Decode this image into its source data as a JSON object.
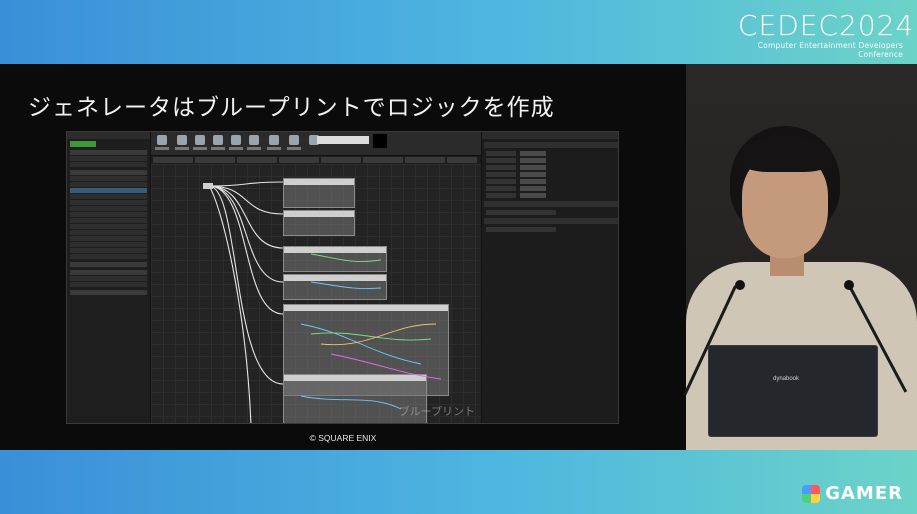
{
  "brand": {
    "event_logo": "CEDEC2024",
    "event_subtitle": "Computer Entertainment Developers Conference",
    "media_logo": "GAMER",
    "media_icon": "gamer-logo-icon"
  },
  "slide": {
    "title": "ジェネレータはブループリントでロジックを作成",
    "copyright": "© SQUARE ENIX",
    "watermark": "ブループリント"
  },
  "speaker": {
    "laptop_brand": "dynabook"
  },
  "colors": {
    "banner_left": "#3a8fd8",
    "banner_right": "#6cd3c8",
    "slide_bg": "#0b0b0c"
  }
}
